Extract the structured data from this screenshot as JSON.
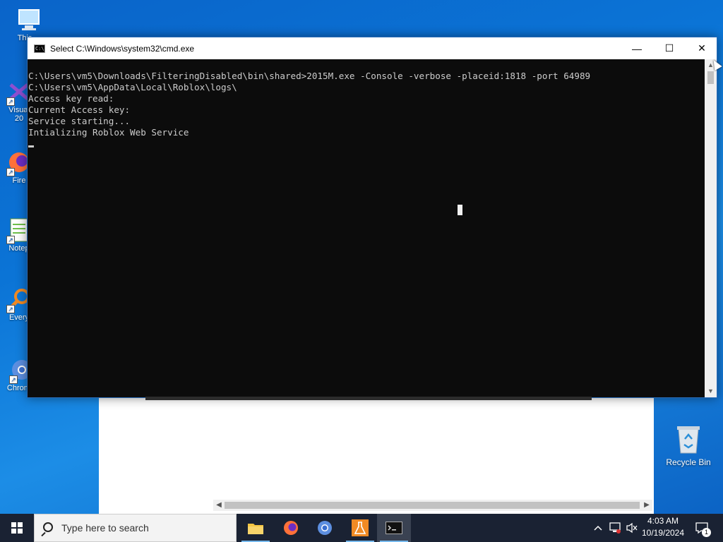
{
  "desktop": {
    "icons": [
      {
        "label": "This"
      },
      {
        "label": "Visual\n20"
      },
      {
        "label": "Fire"
      },
      {
        "label": "Notep"
      },
      {
        "label": "Every"
      },
      {
        "label": "Chrom..."
      }
    ],
    "recycle_bin": "Recycle Bin"
  },
  "cmd": {
    "title": "Select C:\\Windows\\system32\\cmd.exe",
    "lines": [
      "C:\\Users\\vm5\\Downloads\\FilteringDisabled\\bin\\shared>2015M.exe -Console -verbose -placeid:1818 -port 64989",
      "C:\\Users\\vm5\\AppData\\Local\\Roblox\\logs\\",
      "Access key read:",
      "Current Access key:",
      "Service starting...",
      "Intializing Roblox Web Service"
    ],
    "minimize": "—",
    "maximize": "☐",
    "close": "✕"
  },
  "taskbar": {
    "search_placeholder": "Type here to search",
    "time": "4:03 AM",
    "date": "10/19/2024",
    "notification_count": "1",
    "apps": [
      "file-explorer",
      "firefox",
      "chromium",
      "lab-app",
      "cmd"
    ]
  }
}
